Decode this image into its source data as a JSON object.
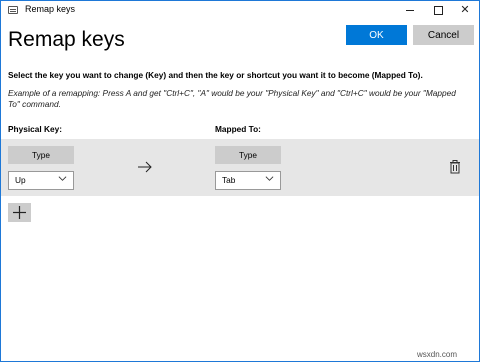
{
  "window": {
    "title": "Remap keys",
    "icon": "keyboard-app-icon",
    "accent_color": "#0078d7"
  },
  "header": {
    "heading": "Remap keys",
    "ok_label": "OK",
    "cancel_label": "Cancel"
  },
  "content": {
    "instruction": "Select the key you want to change (Key) and then the key or shortcut you want it to become (Mapped To).",
    "example": "Example of a remapping: Press A and get \"Ctrl+C\", \"A\" would be your \"Physical Key\" and \"Ctrl+C\" would be your \"Mapped To\" command.",
    "physical_key_label": "Physical Key:",
    "mapped_to_label": "Mapped To:"
  },
  "rows": [
    {
      "physical_type_label": "Type",
      "physical_value": "Up",
      "mapped_type_label": "Type",
      "mapped_value": "Tab"
    }
  ],
  "icons": {
    "arrow": "right-arrow-icon",
    "delete": "trash-icon",
    "add": "plus-icon",
    "dropdown": "chevron-down-icon"
  },
  "watermark": "wsxdn.com"
}
